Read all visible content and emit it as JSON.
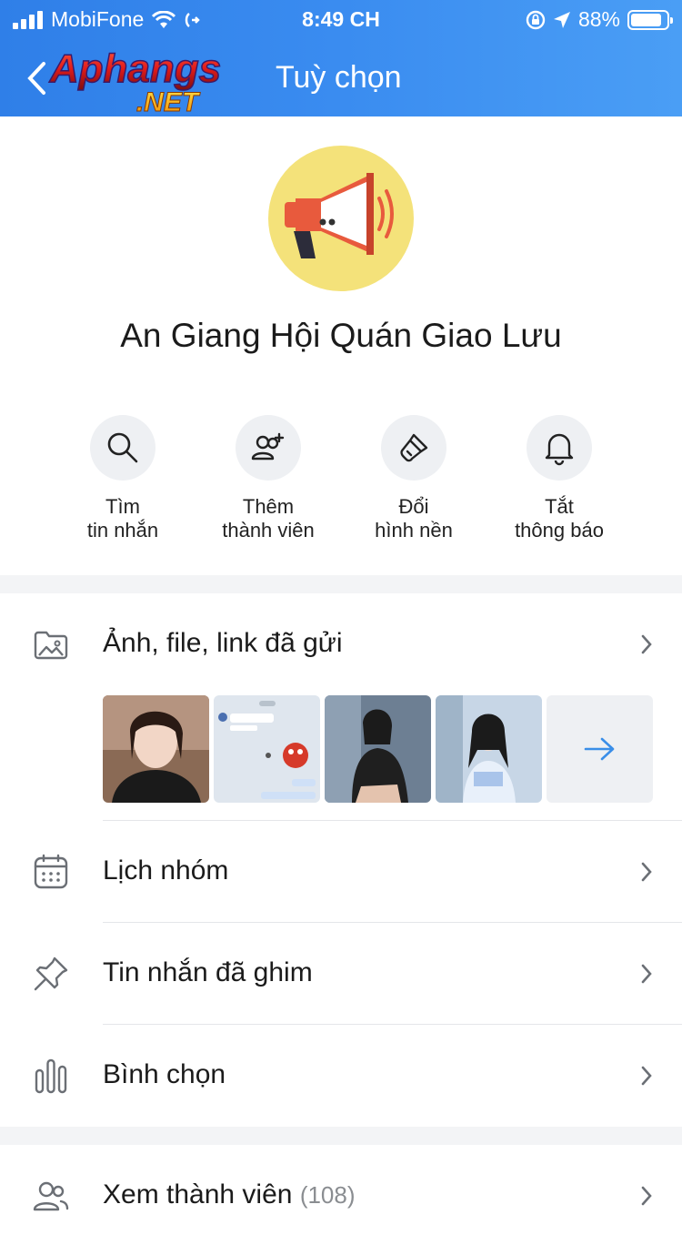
{
  "status_bar": {
    "carrier": "MobiFone",
    "time": "8:49 CH",
    "battery": "88%",
    "battery_level": 0.88
  },
  "navbar": {
    "title": "Tuỳ chọn",
    "logo_text": "Aphangs",
    "logo_subtext": ".NET"
  },
  "group": {
    "name": "An Giang Hội Quán Giao Lưu",
    "avatar_icon": "megaphone-icon"
  },
  "actions": [
    {
      "line1": "Tìm",
      "line2": "tin nhắn",
      "icon": "search-icon"
    },
    {
      "line1": "Thêm",
      "line2": "thành viên",
      "icon": "add-member-icon"
    },
    {
      "line1": "Đổi",
      "line2": "hình nền",
      "icon": "paint-brush-icon"
    },
    {
      "line1": "Tắt",
      "line2": "thông báo",
      "icon": "bell-icon"
    }
  ],
  "media": {
    "label": "Ảnh, file, link đã gửi",
    "icon": "image-folder-icon",
    "more_icon": "arrow-right-icon"
  },
  "menu": {
    "calendar": "Lịch nhóm",
    "pinned": "Tin nhắn đã ghim",
    "poll": "Bình chọn",
    "members": "Xem thành viên",
    "members_count": "(108)"
  },
  "colors": {
    "header": "#3a8cf0",
    "accent": "#3a8ee8",
    "icon_gray": "#6b6f75"
  }
}
